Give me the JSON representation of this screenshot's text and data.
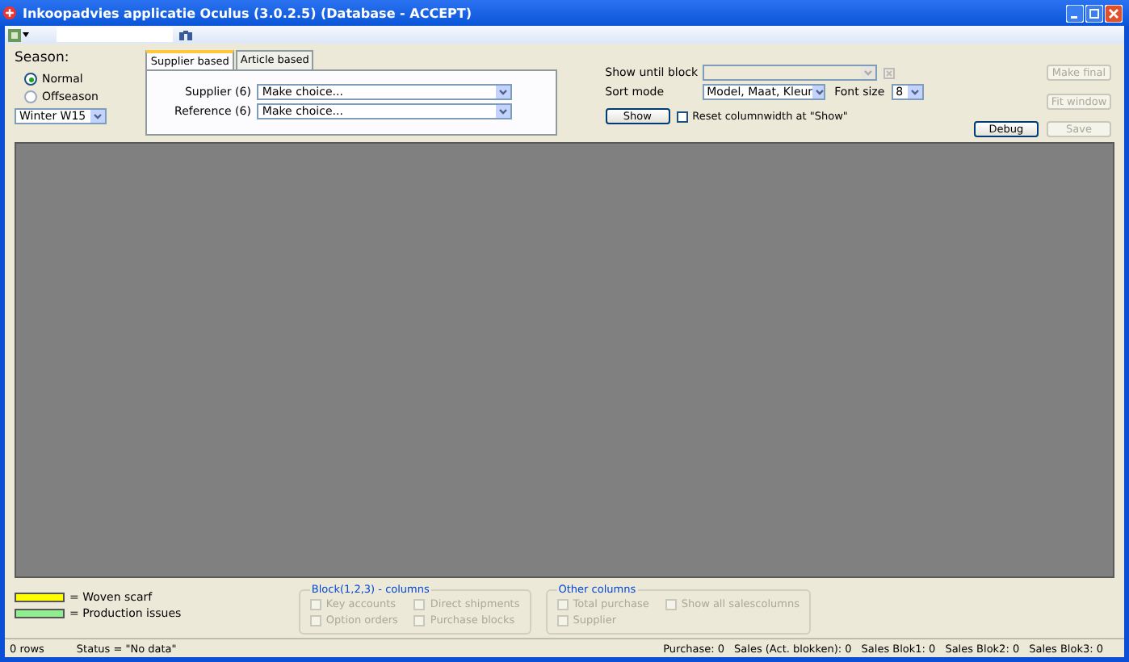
{
  "window": {
    "title": "Inkoopadvies applicatie Oculus (3.0.2.5) (Database - ACCEPT)"
  },
  "season": {
    "label": "Season:",
    "options": [
      {
        "label": "Normal",
        "selected": true
      },
      {
        "label": "Offseason",
        "selected": false
      }
    ],
    "dropdown": "Winter W15"
  },
  "tabs": [
    {
      "label": "Supplier based",
      "selected": true
    },
    {
      "label": "Article based",
      "selected": false
    }
  ],
  "filters": [
    {
      "label": "Supplier (6)",
      "value": "Make choice..."
    },
    {
      "label": "Reference (6)",
      "value": "Make choice..."
    }
  ],
  "show_until_block": {
    "label": "Show until block",
    "disabled": true
  },
  "sort_mode": {
    "label": "Sort mode",
    "value": "Model, Maat, Kleur"
  },
  "font_size": {
    "label": "Font size",
    "value": "8"
  },
  "show_button": "Show",
  "reset_checkbox": {
    "label": "Reset columnwidth at \"Show\"",
    "checked": false
  },
  "buttons": [
    {
      "label": "Make final",
      "disabled": true
    },
    {
      "label": "Fit window",
      "disabled": true
    },
    {
      "label": "Debug",
      "disabled": false
    },
    {
      "label": "Save",
      "disabled": true
    }
  ],
  "legend": [
    {
      "label": "= Woven scarf",
      "color": "#ffff00"
    },
    {
      "label": "= Production issues",
      "color": "#90ee90"
    }
  ],
  "column_groups": [
    {
      "title": "Block(1,2,3) - columns",
      "options": [
        {
          "label": "Key accounts",
          "checked": false,
          "disabled": true
        },
        {
          "label": "Direct shipments",
          "checked": false,
          "disabled": true
        },
        {
          "label": "Option orders",
          "checked": false,
          "disabled": true
        },
        {
          "label": "Purchase blocks",
          "checked": false,
          "disabled": true
        }
      ]
    },
    {
      "title": "Other columns",
      "options": [
        {
          "label": "Total purchase",
          "checked": false,
          "disabled": true
        },
        {
          "label": "Show all salescolumns",
          "checked": false,
          "disabled": true
        },
        {
          "label": "Supplier",
          "checked": false,
          "disabled": true
        }
      ]
    }
  ],
  "status_bar": {
    "rows": "0 rows",
    "status": "Status = \"No data\"",
    "totals": [
      "Purchase: 0",
      "Sales (Act. blokken): 0",
      "Sales Blok1: 0",
      "Sales Blok2: 0",
      "Sales Blok3: 0"
    ]
  }
}
